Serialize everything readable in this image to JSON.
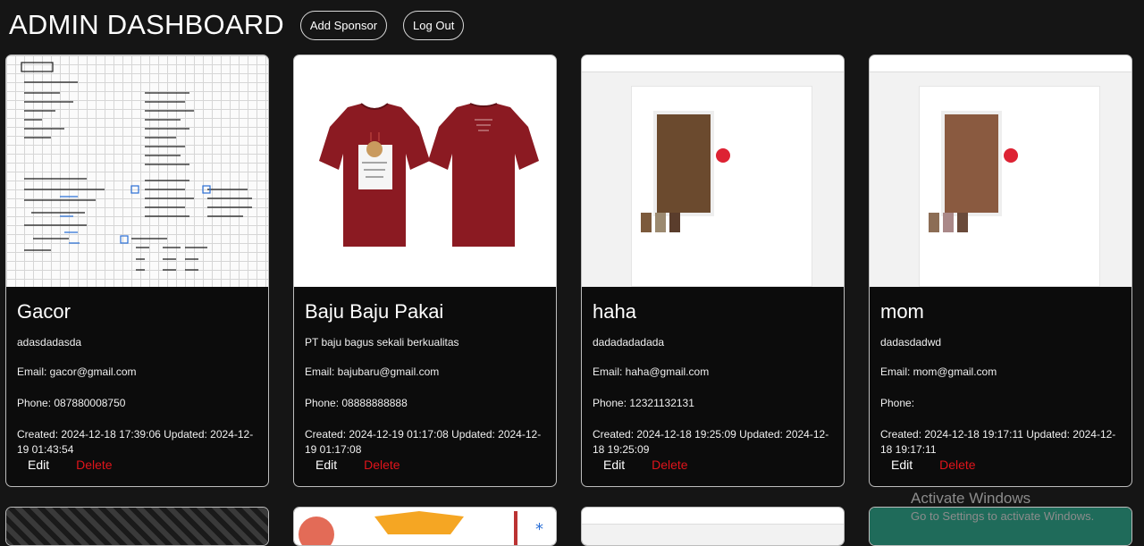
{
  "header": {
    "title": "ADMIN DASHBOARD",
    "add_sponsor_label": "Add Sponsor",
    "logout_label": "Log Out"
  },
  "cards": [
    {
      "name": "Gacor",
      "description": "adasdadasda",
      "email": "Email: gacor@gmail.com",
      "phone": "Phone: 087880008750",
      "timestamps": "Created: 2024-12-18 17:39:06 Updated: 2024-12-19 01:43:54",
      "edit_label": "Edit",
      "delete_label": "Delete",
      "image": "handwritten-notes-image"
    },
    {
      "name": "Baju Baju Pakai",
      "description": "PT baju bagus sekali berkualitas",
      "email": "Email: bajubaru@gmail.com",
      "phone": "Phone: 08888888888",
      "timestamps": "Created: 2024-12-19 01:17:08 Updated: 2024-12-19 01:17:08",
      "edit_label": "Edit",
      "delete_label": "Delete",
      "image": "red-tshirt-image"
    },
    {
      "name": "haha",
      "description": "dadadadadada",
      "email": "Email: haha@gmail.com",
      "phone": "Phone: 12321132131",
      "timestamps": "Created: 2024-12-18 19:25:09 Updated: 2024-12-18 19:25:09",
      "edit_label": "Edit",
      "delete_label": "Delete",
      "image": "website-screenshot-image"
    },
    {
      "name": "mom",
      "description": "dadasdadwd",
      "email": "Email: mom@gmail.com",
      "phone": "Phone:",
      "timestamps": "Created: 2024-12-18 19:17:11 Updated: 2024-12-18 19:17:11",
      "edit_label": "Edit",
      "delete_label": "Delete",
      "image": "website-screenshot-image"
    }
  ],
  "watermark": {
    "line1": "Activate Windows",
    "line2": "Go to Settings to activate Windows."
  },
  "colors": {
    "background": "#151515",
    "card": "#0c0c0c",
    "delete": "#e0141b",
    "tshirt": "#8b1a22"
  }
}
